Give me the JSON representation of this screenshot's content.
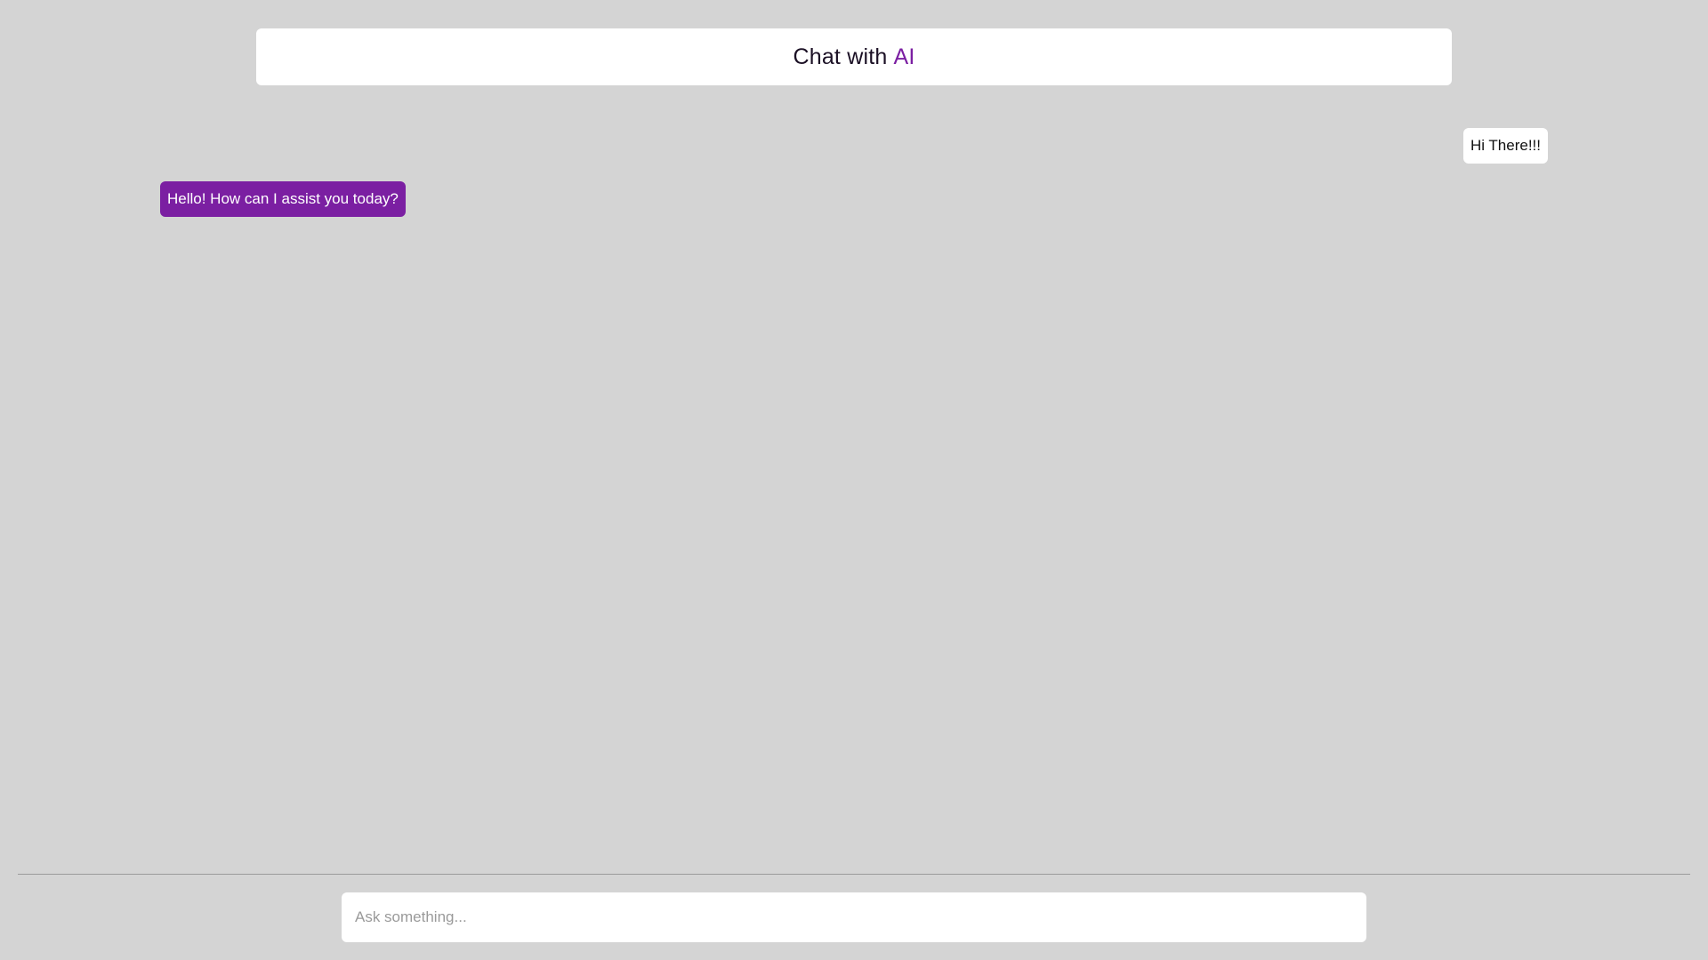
{
  "header": {
    "title_prefix": "Chat with",
    "title_accent": "AI"
  },
  "messages": [
    {
      "role": "user",
      "text": "Hi There!!!"
    },
    {
      "role": "ai",
      "text": "Hello! How can I assist you today?"
    }
  ],
  "composer": {
    "placeholder": "Ask something...",
    "value": ""
  },
  "colors": {
    "background": "#d4d4d4",
    "accent": "#7b1fa2",
    "surface": "#ffffff"
  }
}
